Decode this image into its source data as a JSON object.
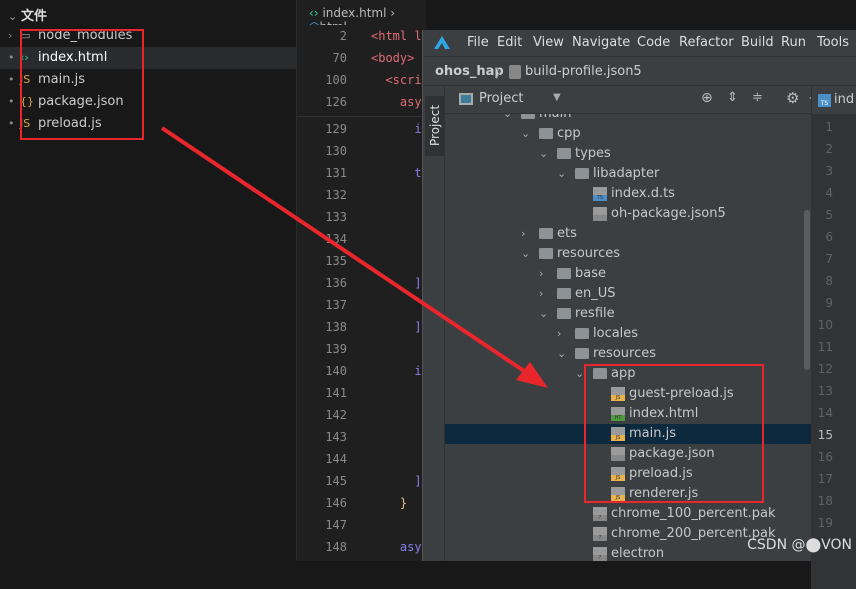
{
  "explorer": {
    "title": "文件",
    "items": [
      {
        "name": "node_modules",
        "icon": "folder-icon",
        "glyph": "▭"
      },
      {
        "name": "index.html",
        "icon": "html-icon",
        "glyph": "‹›"
      },
      {
        "name": "main.js",
        "icon": "js-icon",
        "glyph": "JS"
      },
      {
        "name": "package.json",
        "icon": "json-icon",
        "glyph": "{}"
      },
      {
        "name": "preload.js",
        "icon": "js-icon",
        "glyph": "JS"
      }
    ]
  },
  "editor": {
    "breadcrumb": [
      "index.html",
      "html"
    ],
    "sticky": [
      {
        "n": "2",
        "code": "<html l"
      },
      {
        "n": "70",
        "code": "<body>"
      },
      {
        "n": "100",
        "code": "  <scri"
      },
      {
        "n": "126",
        "code": "    asy"
      }
    ],
    "lines": [
      {
        "n": "129",
        "code": "      i"
      },
      {
        "n": "130",
        "code": ""
      },
      {
        "n": "131",
        "code": "      t"
      },
      {
        "n": "132",
        "code": ""
      },
      {
        "n": "133",
        "code": ""
      },
      {
        "n": "134",
        "code": ""
      },
      {
        "n": "135",
        "code": ""
      },
      {
        "n": "136",
        "code": "      ]"
      },
      {
        "n": "137",
        "code": ""
      },
      {
        "n": "138",
        "code": "      ]"
      },
      {
        "n": "139",
        "code": ""
      },
      {
        "n": "140",
        "code": "      i"
      },
      {
        "n": "141",
        "code": ""
      },
      {
        "n": "142",
        "code": ""
      },
      {
        "n": "143",
        "code": ""
      },
      {
        "n": "144",
        "code": ""
      },
      {
        "n": "145",
        "code": "      ]"
      },
      {
        "n": "146",
        "code": "    }"
      },
      {
        "n": "147",
        "code": ""
      },
      {
        "n": "148",
        "code": "    asy"
      }
    ]
  },
  "ide": {
    "menu": [
      "File",
      "Edit",
      "View",
      "Navigate",
      "Code",
      "Refactor",
      "Build",
      "Run",
      "Tools"
    ],
    "project": "ohos_hap",
    "file": "build-profile.json5",
    "tool_window": "Project",
    "view_selector": "Project",
    "editor_tab": "ind",
    "tree": [
      {
        "label": "main",
        "depth": 0,
        "type": "folder",
        "arrow": "v"
      },
      {
        "label": "cpp",
        "depth": 1,
        "type": "folder",
        "arrow": "v"
      },
      {
        "label": "types",
        "depth": 2,
        "type": "folder",
        "arrow": "v"
      },
      {
        "label": "libadapter",
        "depth": 3,
        "type": "folder",
        "arrow": "v"
      },
      {
        "label": "index.d.ts",
        "depth": 4,
        "type": "ts"
      },
      {
        "label": "oh-package.json5",
        "depth": 4,
        "type": "json"
      },
      {
        "label": "ets",
        "depth": 1,
        "type": "folder",
        "arrow": ">"
      },
      {
        "label": "resources",
        "depth": 1,
        "type": "folder",
        "arrow": "v"
      },
      {
        "label": "base",
        "depth": 2,
        "type": "folder",
        "arrow": ">"
      },
      {
        "label": "en_US",
        "depth": 2,
        "type": "folder",
        "arrow": ">"
      },
      {
        "label": "resfile",
        "depth": 2,
        "type": "folder",
        "arrow": "v"
      },
      {
        "label": "locales",
        "depth": 3,
        "type": "folder",
        "arrow": ">"
      },
      {
        "label": "resources",
        "depth": 3,
        "type": "folder",
        "arrow": "v"
      },
      {
        "label": "app",
        "depth": 4,
        "type": "folder",
        "arrow": "v"
      },
      {
        "label": "guest-preload.js",
        "depth": 5,
        "type": "js"
      },
      {
        "label": "index.html",
        "depth": 5,
        "type": "html"
      },
      {
        "label": "main.js",
        "depth": 5,
        "type": "js",
        "selected": true
      },
      {
        "label": "package.json",
        "depth": 5,
        "type": "json"
      },
      {
        "label": "preload.js",
        "depth": 5,
        "type": "js"
      },
      {
        "label": "renderer.js",
        "depth": 5,
        "type": "js"
      },
      {
        "label": "chrome_100_percent.pak",
        "depth": 4,
        "type": "unknown"
      },
      {
        "label": "chrome_200_percent.pak",
        "depth": 4,
        "type": "unknown"
      },
      {
        "label": "electron",
        "depth": 4,
        "type": "unknown"
      }
    ],
    "gutter": [
      "1",
      "2",
      "3",
      "4",
      "5",
      "6",
      "7",
      "8",
      "9",
      "10",
      "11",
      "12",
      "13",
      "14",
      "15",
      "16",
      "17",
      "18",
      "19"
    ],
    "current_line": "15"
  },
  "watermark": "CSDN @⬤VON",
  "colors": {
    "annotation": "#e8262b",
    "selection": "#0d293e",
    "js": "#f0c674",
    "html": "#4e9a3e"
  }
}
